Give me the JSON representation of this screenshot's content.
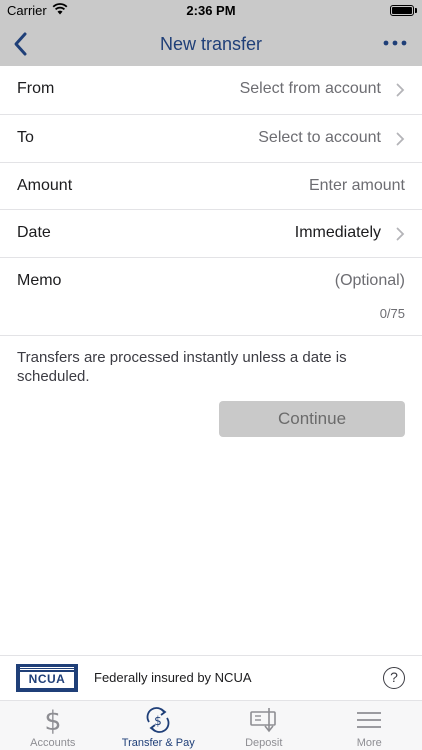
{
  "status_bar": {
    "carrier": "Carrier",
    "time": "2:36 PM"
  },
  "nav": {
    "title": "New transfer",
    "back_icon": "chevron-left-icon",
    "more_icon": "ellipsis-icon"
  },
  "form": {
    "from": {
      "label": "From",
      "value": "Select from account"
    },
    "to": {
      "label": "To",
      "value": "Select to account"
    },
    "amount": {
      "label": "Amount",
      "placeholder": "Enter amount"
    },
    "date": {
      "label": "Date",
      "value": "Immediately"
    },
    "memo": {
      "label": "Memo",
      "placeholder": "(Optional)",
      "counter": "0/75"
    }
  },
  "info_text": "Transfers are processed instantly unless a date is scheduled.",
  "continue_label": "Continue",
  "footer": {
    "logo_text": "NCUA",
    "insured_text": "Federally insured by NCUA",
    "help_symbol": "?"
  },
  "tabs": [
    {
      "label": "Accounts",
      "icon": "dollar-icon",
      "active": false
    },
    {
      "label": "Transfer & Pay",
      "icon": "transfer-dollar-icon",
      "active": true
    },
    {
      "label": "Deposit",
      "icon": "check-deposit-icon",
      "active": false
    },
    {
      "label": "More",
      "icon": "menu-icon",
      "active": false
    }
  ],
  "colors": {
    "brand": "#1f3f78",
    "header_bg": "#c9c9c9",
    "disabled_button": "#c9c9c9"
  }
}
